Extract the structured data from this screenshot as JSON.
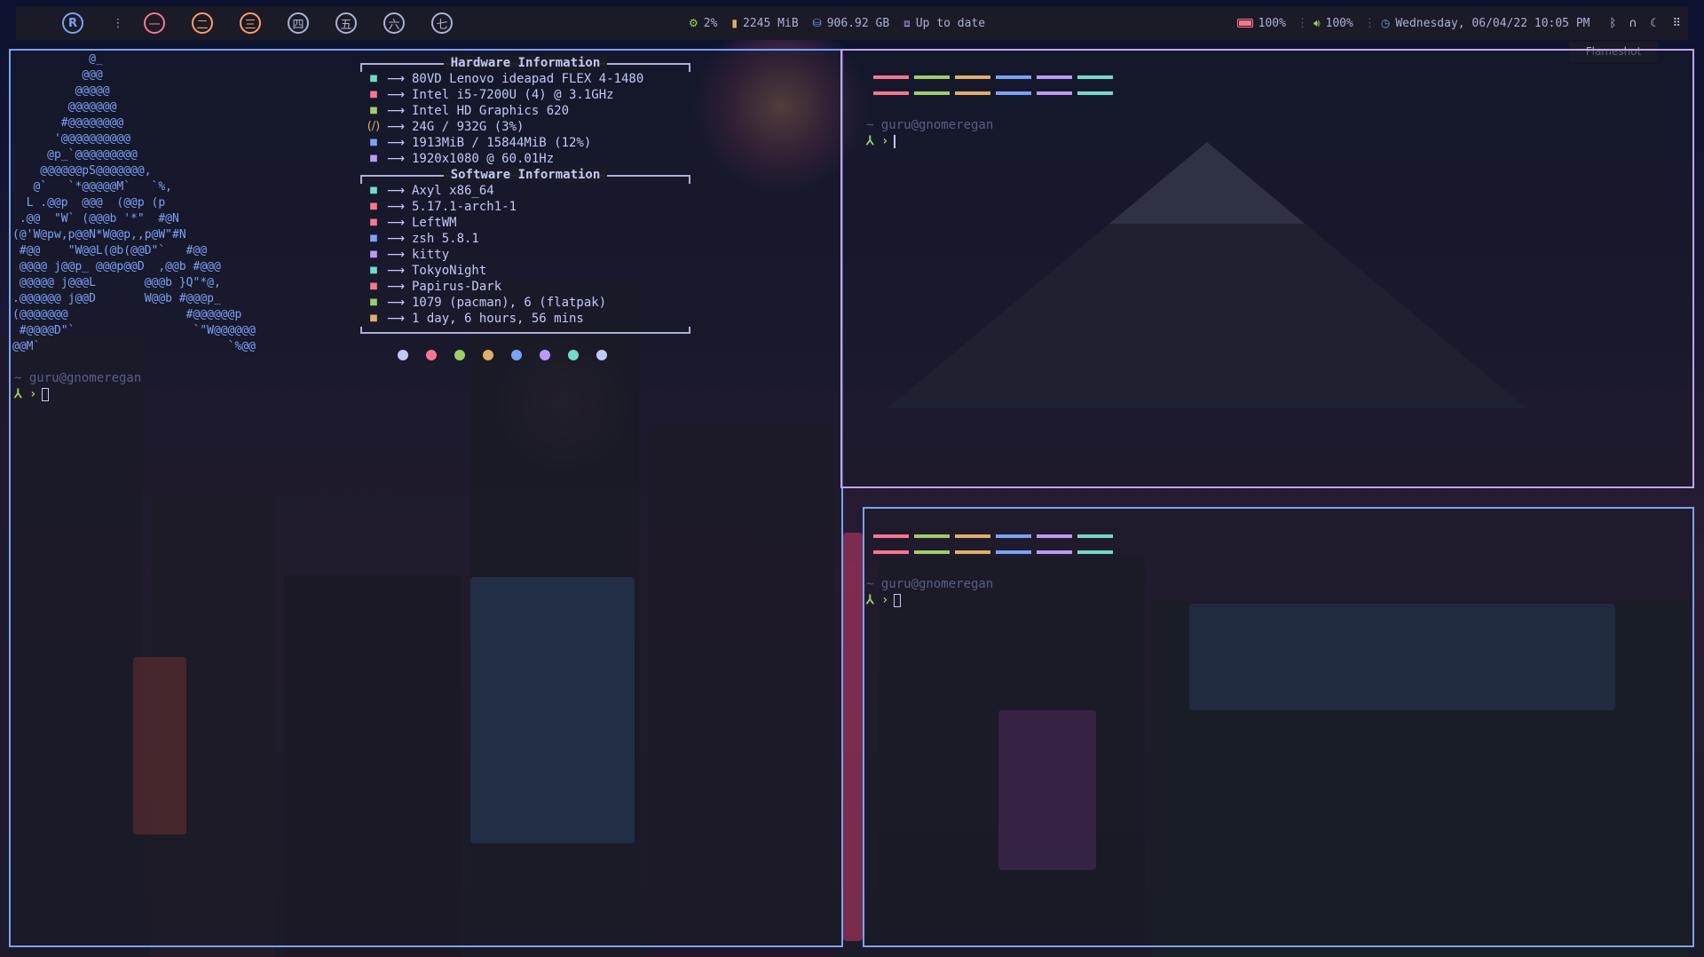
{
  "topbar": {
    "workspaces": [
      "R",
      "一",
      "二",
      "三",
      "四",
      "五",
      "六",
      "七"
    ],
    "cpu": "2%",
    "memory": "2245 MiB",
    "disk": "906.92 GB",
    "updates": "Up to date",
    "battery": "100%",
    "volume": "100%",
    "datetime": "Wednesday, 06/04/22 10:05 PM",
    "icons": {
      "cpu": "chip-icon",
      "memory": "memory-icon",
      "disk": "disk-icon",
      "updates": "package-icon",
      "battery": "battery-icon",
      "volume": "volume-icon",
      "clock": "clock-icon",
      "bluetooth": "bluetooth-icon",
      "headphones": "headphones-icon",
      "night": "moon-icon",
      "menu": "grid-icon"
    }
  },
  "flameshot": "Flameshot",
  "left_terminal": {
    "ascii": "           @_\n          @@@\n         @@@@@\n        @@@@@@@\n       #@@@@@@@@\n      '@@@@@@@@@@\n     @p_`@@@@@@@@@\n    @@@@@@pS@@@@@@@,\n   @`   `*@@@@@M`   `%,\n  L .@@p  @@@  (@@p (p\n .@@  \"W` (@@@b '*\"  #@N\n(@'W@pw,p@@N*W@@p,,p@W\"#N\n #@@    \"W@@L(@b(@@D\"`   #@@\n @@@@ j@@p_ @@@p@@D  ,@@b #@@@\n @@@@@ j@@@L       @@@b }Q\"*@,\n.@@@@@@ j@@D       W@@b #@@@p_\n(@@@@@@@                 #@@@@@@p\n #@@@@D\"`                 `\"W@@@@@@\n@@M`                           `%@@",
    "hardware_header": "Hardware Information",
    "software_header": "Software Information",
    "hardware": [
      {
        "icon": "laptop-icon",
        "color": "#73daca",
        "value": "80VD Lenovo ideapad FLEX 4-1480"
      },
      {
        "icon": "cpu-icon",
        "color": "#f7768e",
        "value": "Intel i5-7200U (4) @ 3.1GHz"
      },
      {
        "icon": "gpu-icon",
        "color": "#9ece6a",
        "value": "Intel HD Graphics 620"
      },
      {
        "icon": "disk-icon",
        "color": "#e0af68",
        "glyph": "(/)",
        "value": "24G / 932G (3%)"
      },
      {
        "icon": "memory-icon",
        "color": "#7aa2f7",
        "value": "1913MiB / 15844MiB (12%)"
      },
      {
        "icon": "monitor-icon",
        "color": "#bb9af7",
        "value": "1920x1080 @ 60.01Hz"
      }
    ],
    "software": [
      {
        "icon": "distro-icon",
        "color": "#73daca",
        "value": "Axyl x86_64"
      },
      {
        "icon": "kernel-icon",
        "color": "#f7768e",
        "value": "5.17.1-arch1-1"
      },
      {
        "icon": "wm-icon",
        "color": "#f7768e",
        "value": "LeftWM"
      },
      {
        "icon": "shell-icon",
        "color": "#7aa2f7",
        "value": "zsh 5.8.1"
      },
      {
        "icon": "terminal-icon",
        "color": "#bb9af7",
        "value": "kitty"
      },
      {
        "icon": "theme-icon",
        "color": "#73daca",
        "value": "TokyoNight"
      },
      {
        "icon": "icons-icon",
        "color": "#f7768e",
        "value": "Papirus-Dark"
      },
      {
        "icon": "package-icon",
        "color": "#9ece6a",
        "value": "1079 (pacman), 6 (flatpak)"
      },
      {
        "icon": "uptime-icon",
        "color": "#e0af68",
        "value": "1 day, 6 hours, 56 mins"
      }
    ],
    "dots": [
      "#c0caf5",
      "#f7768e",
      "#9ece6a",
      "#e0af68",
      "#7aa2f7",
      "#bb9af7",
      "#73daca",
      "#c0caf5"
    ],
    "prompt_path": "~ guru@gnomeregan",
    "prompt_symbol": "⅄ ›"
  },
  "right_top_terminal": {
    "prompt_path": "~ guru@gnomeregan",
    "prompt_symbol": "⅄ ›"
  },
  "right_bottom_terminal": {
    "prompt_path": "~ guru@gnomeregan",
    "prompt_symbol": "⅄ ›"
  },
  "palette_rows": [
    [
      "#f7768e",
      "#9ece6a",
      "#e0af68",
      "#7aa2f7",
      "#bb9af7",
      "#73daca"
    ],
    [
      "#f7768e",
      "#9ece6a",
      "#e0af68",
      "#7aa2f7",
      "#bb9af7",
      "#73daca"
    ]
  ]
}
